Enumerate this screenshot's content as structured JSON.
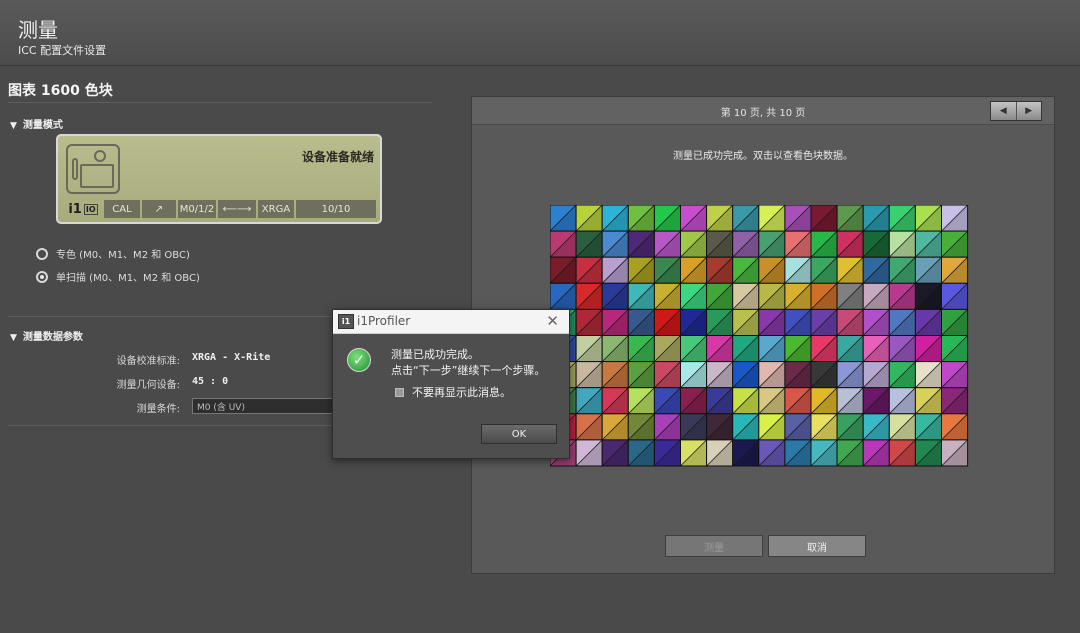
{
  "header": {
    "title": "测量",
    "subtitle": "ICC 配置文件设置"
  },
  "left": {
    "chart_title": "图表 1600 色块",
    "measure_mode": {
      "heading": "测量模式",
      "device": {
        "status": "设备准备就绪",
        "logo": "i1",
        "logo_tag": "IO",
        "chips": [
          "CAL",
          "↗",
          "M0/1/2",
          "⟵⟶",
          "XRGA",
          "10/10"
        ]
      },
      "options": [
        {
          "label": "专色 (M0、M1、M2 和 OBC)",
          "selected": false
        },
        {
          "label": "单扫描 (M0、M1、M2 和 OBC)",
          "selected": true
        }
      ]
    },
    "measure_params": {
      "heading": "测量数据参数",
      "rows": [
        {
          "label": "设备校准标准:",
          "value": "XRGA - X-Rite"
        },
        {
          "label": "测量几何设备:",
          "value": "45 : 0"
        },
        {
          "label": "测量条件:",
          "value": "M0 (含 UV)"
        }
      ]
    }
  },
  "right": {
    "page_info": "第 10 页, 共 10 页",
    "message": "测量已成功完成。双击以查看色块数据。",
    "buttons": {
      "measure": "测量",
      "cancel": "取消"
    },
    "patch_colors": [
      "#2d7fd0",
      "#b8d23a",
      "#2bb3d8",
      "#70c040",
      "#23c84a",
      "#c84ed0",
      "#c0d048",
      "#3a9aa8",
      "#d8f058",
      "#a84fb8",
      "#7a1a30",
      "#5e9a4e",
      "#2b9ab0",
      "#3ad070",
      "#a8e050",
      "#c8c0e8",
      "#b83a70",
      "#2a6040",
      "#4a8ad0",
      "#502878",
      "#b858c8",
      "#a0c848",
      "#5a5a4a",
      "#9060a8",
      "#48a070",
      "#e87070",
      "#28b848",
      "#d03060",
      "#186838",
      "#b8e0a0",
      "#50b8a0",
      "#48b038",
      "#7a1c2a",
      "#c83040",
      "#b8a0d0",
      "#a8a020",
      "#3a8850",
      "#d8a028",
      "#a83a30",
      "#48b840",
      "#c8902a",
      "#a8e0e0",
      "#3aa860",
      "#e0c030",
      "#3068a0",
      "#40a870",
      "#68a0b8",
      "#e0a838",
      "#2868c0",
      "#d82828",
      "#2a3a9a",
      "#40b8b8",
      "#c8b030",
      "#3ad880",
      "#40a838",
      "#d8c8a0",
      "#b8b848",
      "#d8b030",
      "#d07028",
      "#808080",
      "#c8a8c0",
      "#b83a90",
      "#1a1a28",
      "#5858e0",
      "#28a870",
      "#b02838",
      "#b8287a",
      "#385890",
      "#d01818",
      "#202898",
      "#2a9a58",
      "#b8c050",
      "#8838a8",
      "#4050c0",
      "#6a40a8",
      "#c84a78",
      "#b050c8",
      "#5078c0",
      "#6838a8",
      "#30a040",
      "#3a58c0",
      "#c0d0a0",
      "#8ab870",
      "#3ab850",
      "#a8a860",
      "#48c878",
      "#d838a8",
      "#20a880",
      "#58a8d0",
      "#4ab830",
      "#e83868",
      "#38a8a0",
      "#e860b8",
      "#9858c0",
      "#d020a0",
      "#28b858",
      "#b8c068",
      "#c8b8a0",
      "#c87840",
      "#5aa040",
      "#c84a60",
      "#a8e8e8",
      "#c8b8c8",
      "#1a58c8",
      "#e0b8b0",
      "#6a2a48",
      "#383838",
      "#8a98d8",
      "#b8a8d0",
      "#30b860",
      "#e8e0c8",
      "#c048c8",
      "#4a9050",
      "#40a8c0",
      "#d83858",
      "#b8e060",
      "#3a48b8",
      "#8a2050",
      "#3a3a98",
      "#c8e048",
      "#d8c880",
      "#d85848",
      "#e0b828",
      "#b8c0d8",
      "#6a1868",
      "#b8c0e0",
      "#d8d058",
      "#8a2878",
      "#d82848",
      "#d87048",
      "#d8a838",
      "#708838",
      "#a840b8",
      "#3a3a58",
      "#402838",
      "#28b8b8",
      "#d8f048",
      "#5860a8",
      "#e8e060",
      "#38a060",
      "#38b8c8",
      "#d8e0a0",
      "#38b8a0",
      "#e87840",
      "#b84a88",
      "#d0b8d8",
      "#4a2870",
      "#2a6888",
      "#3a2a98",
      "#d8e068",
      "#d8d0b8",
      "#1a1a50",
      "#6858b8",
      "#2a7aa8",
      "#48b8c0",
      "#40a850",
      "#b838b8",
      "#d04848",
      "#208850",
      "#c8b0c0"
    ]
  }
}
